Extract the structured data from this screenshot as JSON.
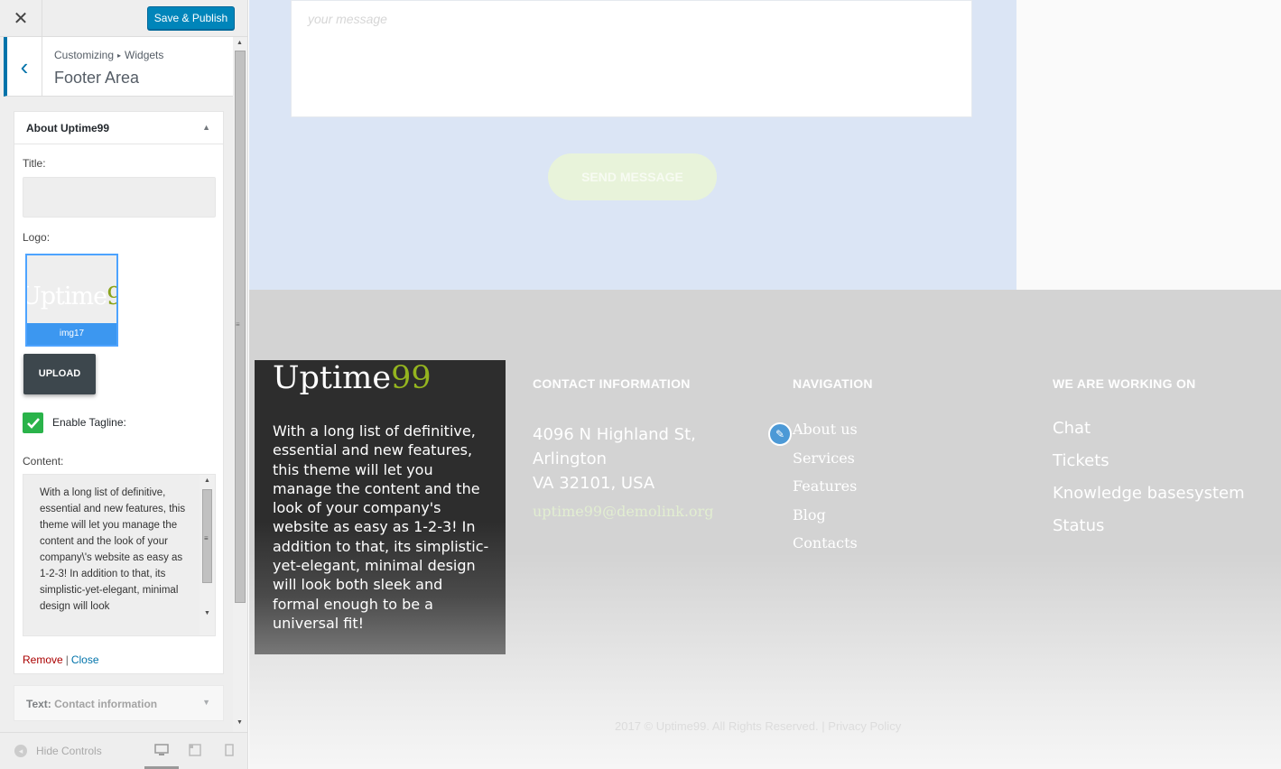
{
  "topbar": {
    "close_glyph": "✕",
    "publish_label": "Save & Publish"
  },
  "panel": {
    "back_glyph": "‹",
    "breadcrumb_root": "Customizing",
    "breadcrumb_sep": "▸",
    "breadcrumb_current": "Widgets",
    "section_title": "Footer Area"
  },
  "widget": {
    "title": "About Uptime99",
    "toggle_glyph": "▲",
    "title_label": "Title:",
    "title_value": "",
    "logo_label": "Logo:",
    "logo_thumb_word": "Uptime",
    "logo_thumb_num": "99",
    "logo_caption": "img17",
    "upload_label": "UPLOAD",
    "tagline_label": "Enable Tagline:",
    "tagline_checked": true,
    "content_label": "Content:",
    "content_text": "With a long list of definitive, essential and new features, this theme will let you manage the content and the look of your company\\'s website as easy as 1-2-3! In addition to that, its simplistic-yet-elegant, minimal design will look",
    "remove_label": "Remove",
    "separator": "|",
    "close_label": "Close"
  },
  "widget2": {
    "prefix": "Text:",
    "title": "Contact information",
    "toggle_glyph": "▼"
  },
  "footer_bar": {
    "hide_label": "Hide Controls",
    "hide_icon": "◂",
    "devices": [
      "desktop-icon",
      "tablet-icon",
      "mobile-icon"
    ]
  },
  "preview": {
    "message_placeholder": "your message",
    "send_label": "SEND MESSAGE",
    "about": {
      "logo_word": "Uptime",
      "logo_num": "99",
      "text": "With a long list of definitive, essential and new features, this theme will let you manage the content and the look of your company's website as easy as 1-2-3! In addition to that, its simplistic-yet-elegant, minimal design will look both sleek and formal enough to be a universal fit!"
    },
    "contact": {
      "heading": "CONTACT INFORMATION",
      "address_line1": "4096 N Highland St,",
      "address_line2": "Arlington",
      "address_line3": "VA 32101, USA",
      "email": "uptime99@demolink.org"
    },
    "navigation": {
      "heading": "NAVIGATION",
      "links": [
        "About us",
        "Services",
        "Features",
        "Blog",
        "Contacts"
      ]
    },
    "working": {
      "heading": "WE ARE WORKING ON",
      "items": [
        "Chat",
        "Tickets",
        "Knowledge basesystem",
        "Status"
      ]
    },
    "copyright": "2017 © Uptime99. All Rights Reserved.",
    "copyright_sep": "|",
    "privacy": "Privacy Policy"
  },
  "colors": {
    "publish": "#0085ba",
    "accent_green": "#94b41f",
    "contact_bg": "#dbe5f5",
    "footer_bg": "#d3d3d3"
  }
}
